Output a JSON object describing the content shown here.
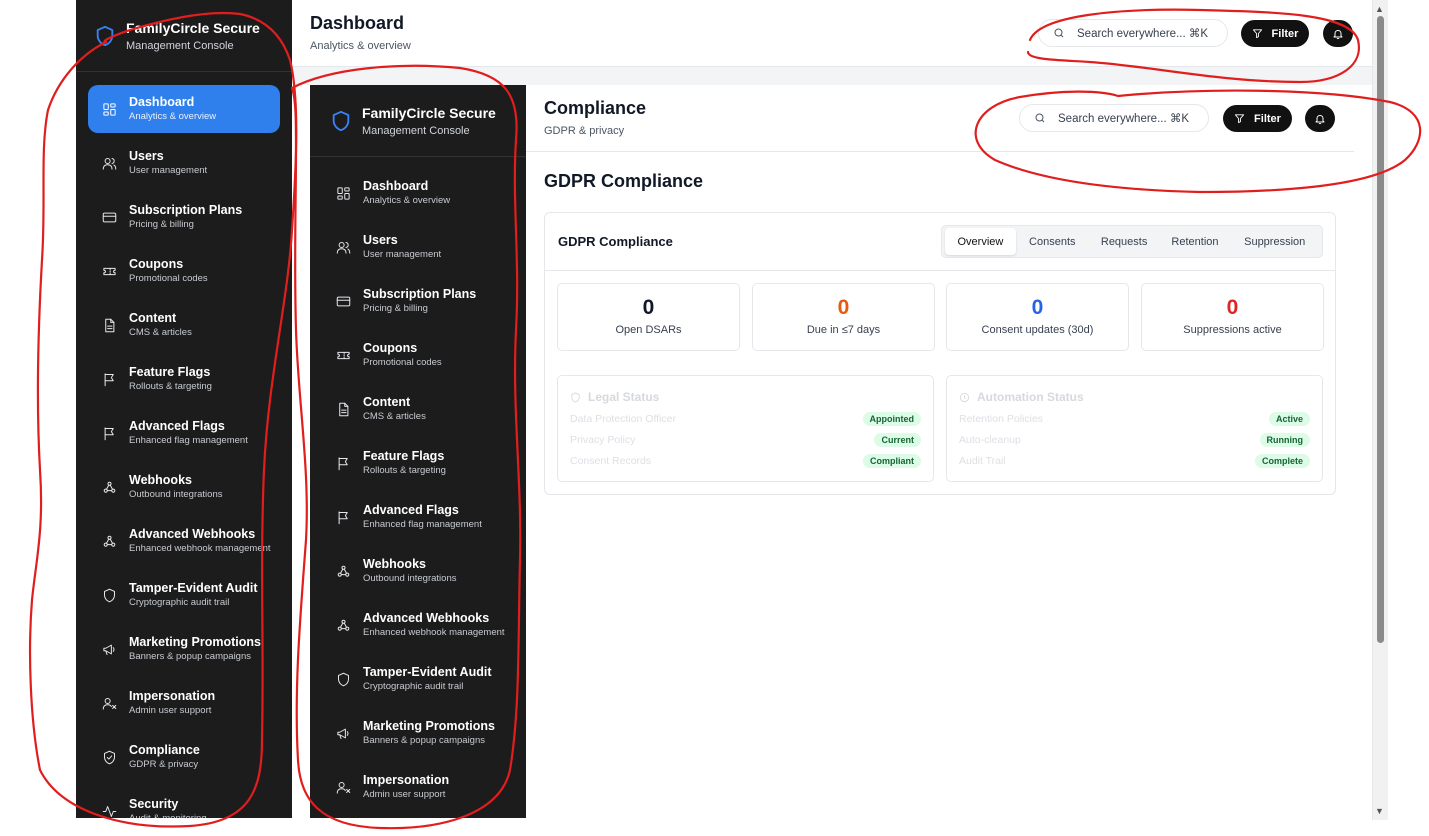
{
  "brand": {
    "title": "FamilyCircle Secure",
    "subtitle": "Management Console",
    "accent": "#2f80ed",
    "sidebar_bg": "#1c1c1c"
  },
  "outer_nav": [
    {
      "label": "Dashboard",
      "sub": "Analytics & overview",
      "icon": "dashboard-icon",
      "active": true
    },
    {
      "label": "Users",
      "sub": "User management",
      "icon": "users-icon"
    },
    {
      "label": "Subscription Plans",
      "sub": "Pricing & billing",
      "icon": "credit-card-icon"
    },
    {
      "label": "Coupons",
      "sub": "Promotional codes",
      "icon": "ticket-icon"
    },
    {
      "label": "Content",
      "sub": "CMS & articles",
      "icon": "document-icon"
    },
    {
      "label": "Feature Flags",
      "sub": "Rollouts & targeting",
      "icon": "flag-icon"
    },
    {
      "label": "Advanced Flags",
      "sub": "Enhanced flag management",
      "icon": "flag-icon"
    },
    {
      "label": "Webhooks",
      "sub": "Outbound integrations",
      "icon": "webhook-icon"
    },
    {
      "label": "Advanced Webhooks",
      "sub": "Enhanced webhook management",
      "icon": "webhook-icon"
    },
    {
      "label": "Tamper-Evident Audit",
      "sub": "Cryptographic audit trail",
      "icon": "shield-icon"
    },
    {
      "label": "Marketing Promotions",
      "sub": "Banners & popup campaigns",
      "icon": "megaphone-icon"
    },
    {
      "label": "Impersonation",
      "sub": "Admin user support",
      "icon": "user-x-icon"
    },
    {
      "label": "Compliance",
      "sub": "GDPR & privacy",
      "icon": "shield-check-icon"
    },
    {
      "label": "Security",
      "sub": "Audit & monitoring",
      "icon": "activity-icon"
    }
  ],
  "inner_nav": [
    {
      "label": "Dashboard",
      "sub": "Analytics & overview",
      "icon": "dashboard-icon"
    },
    {
      "label": "Users",
      "sub": "User management",
      "icon": "users-icon"
    },
    {
      "label": "Subscription Plans",
      "sub": "Pricing & billing",
      "icon": "credit-card-icon"
    },
    {
      "label": "Coupons",
      "sub": "Promotional codes",
      "icon": "ticket-icon"
    },
    {
      "label": "Content",
      "sub": "CMS & articles",
      "icon": "document-icon"
    },
    {
      "label": "Feature Flags",
      "sub": "Rollouts & targeting",
      "icon": "flag-icon"
    },
    {
      "label": "Advanced Flags",
      "sub": "Enhanced flag management",
      "icon": "flag-icon"
    },
    {
      "label": "Webhooks",
      "sub": "Outbound integrations",
      "icon": "webhook-icon"
    },
    {
      "label": "Advanced Webhooks",
      "sub": "Enhanced webhook management",
      "icon": "webhook-icon"
    },
    {
      "label": "Tamper-Evident Audit",
      "sub": "Cryptographic audit trail",
      "icon": "shield-icon"
    },
    {
      "label": "Marketing Promotions",
      "sub": "Banners & popup campaigns",
      "icon": "megaphone-icon"
    },
    {
      "label": "Impersonation",
      "sub": "Admin user support",
      "icon": "user-x-icon"
    }
  ],
  "outer_header": {
    "title": "Dashboard",
    "subtitle": "Analytics & overview",
    "search_text": "Search everywhere... ⌘K",
    "filter_label": "Filter"
  },
  "inner_header": {
    "title": "Compliance",
    "subtitle": "GDPR & privacy",
    "search_text": "Search everywhere... ⌘K",
    "filter_label": "Filter"
  },
  "compliance": {
    "section_title": "GDPR Compliance",
    "card_title": "GDPR Compliance",
    "tabs": [
      "Overview",
      "Consents",
      "Requests",
      "Retention",
      "Suppression"
    ],
    "active_tab": "Overview",
    "stats": [
      {
        "value": "0",
        "label": "Open DSARs",
        "color": "#111827"
      },
      {
        "value": "0",
        "label": "Due in ≤7 days",
        "color": "#ea580c"
      },
      {
        "value": "0",
        "label": "Consent updates (30d)",
        "color": "#2563eb"
      },
      {
        "value": "0",
        "label": "Suppressions active",
        "color": "#dc2626"
      }
    ],
    "legal": {
      "title": "Legal Status",
      "rows": [
        {
          "label": "Data Protection Officer",
          "status": "Appointed"
        },
        {
          "label": "Privacy Policy",
          "status": "Current"
        },
        {
          "label": "Consent Records",
          "status": "Compliant"
        }
      ]
    },
    "automation": {
      "title": "Automation Status",
      "rows": [
        {
          "label": "Retention Policies",
          "status": "Active"
        },
        {
          "label": "Auto-cleanup",
          "status": "Running"
        },
        {
          "label": "Audit Trail",
          "status": "Complete"
        }
      ]
    }
  },
  "annotation_color": "#e01e1e"
}
